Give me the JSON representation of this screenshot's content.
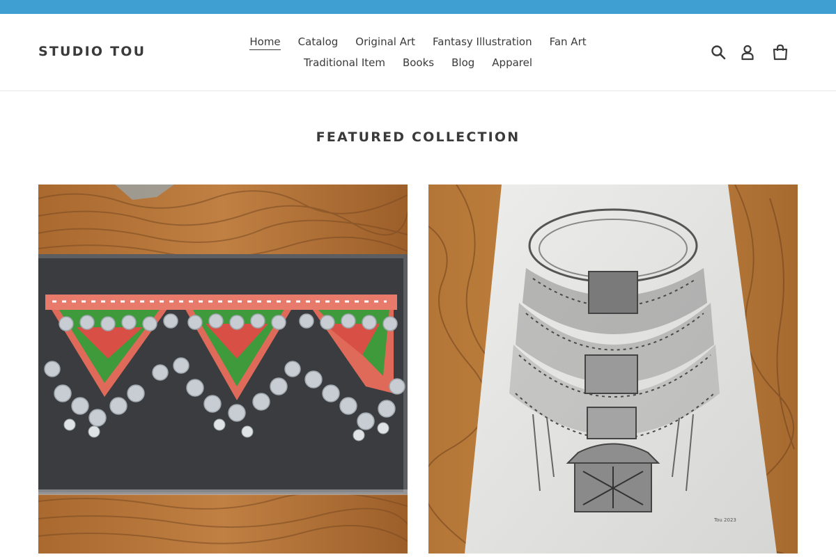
{
  "colors": {
    "topbar": "#3f9fd3",
    "text": "#3a3a3a",
    "wood": "#b5773f",
    "wood_dark": "#7a4a22",
    "panel_dark": "#3a3c40",
    "paper": "#e4e4e2"
  },
  "header": {
    "logo": "STUDIO TOU",
    "nav_row_1": [
      "Home",
      "Catalog",
      "Original Art",
      "Fantasy Illustration",
      "Fan Art"
    ],
    "nav_row_2": [
      "Traditional Item",
      "Books",
      "Blog",
      "Apparel"
    ],
    "active_nav": "Home",
    "icons": [
      "search-icon",
      "account-icon",
      "cart-icon"
    ]
  },
  "featured": {
    "title": "FEATURED COLLECTION",
    "products": [
      {
        "image": "hmong-coin-apron-painting-photo"
      },
      {
        "image": "silver-necklace-pencil-drawing-photo",
        "signature": "Tou 2023"
      }
    ]
  }
}
